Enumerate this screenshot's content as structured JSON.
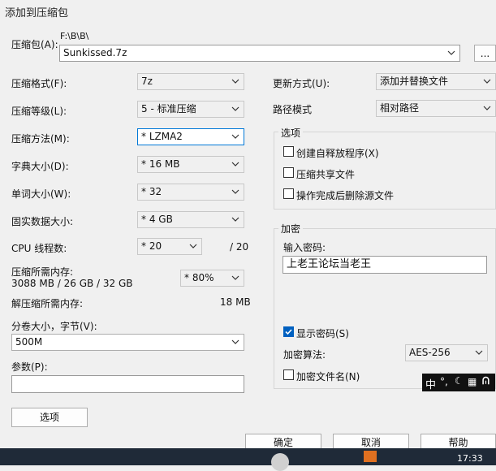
{
  "window": {
    "title": "添加到压缩包"
  },
  "archive": {
    "label": "压缩包(A):",
    "path": "F:\\B\\B\\",
    "name": "Sunkissed.7z",
    "browse": "..."
  },
  "left": {
    "format": {
      "label": "压缩格式(F):",
      "value": "7z"
    },
    "level": {
      "label": "压缩等级(L):",
      "value": "5 - 标准压缩"
    },
    "method": {
      "label": "压缩方法(M):",
      "value": "* LZMA2"
    },
    "dict": {
      "label": "字典大小(D):",
      "value": "* 16 MB"
    },
    "word": {
      "label": "单词大小(W):",
      "value": "* 32"
    },
    "solid": {
      "label": "固实数据大小:",
      "value": "* 4 GB"
    },
    "threads": {
      "label": "CPU 线程数:",
      "value": "* 20",
      "max": "/ 20"
    },
    "mem": {
      "label": "压缩所需内存:",
      "detail": "3088 MB / 26 GB / 32 GB",
      "value": "* 80%"
    },
    "decomp": {
      "label": "解压缩所需内存:",
      "value": "18 MB"
    },
    "split": {
      "label": "分卷大小，字节(V):",
      "value": "500M"
    },
    "params": {
      "label": "参数(P):",
      "value": ""
    },
    "options_btn": "选项"
  },
  "right": {
    "update": {
      "label": "更新方式(U):",
      "value": "添加并替换文件"
    },
    "pathmode": {
      "label": "路径模式",
      "value": "相对路径"
    },
    "options": {
      "title": "选项",
      "sfx": "创建自释放程序(X)",
      "shared": "压缩共享文件",
      "delete": "操作完成后删除源文件"
    },
    "encrypt": {
      "title": "加密",
      "pwd_label": "输入密码:",
      "pwd_value": "上老王论坛当老王",
      "show_pwd": "显示密码(S)",
      "algo_label": "加密算法:",
      "algo_value": "AES-256",
      "enc_names": "加密文件名(N)"
    }
  },
  "buttons": {
    "ok": "确定",
    "cancel": "取消",
    "help": "帮助"
  },
  "ime": {
    "text": "中"
  },
  "taskbar": {
    "time": "17:33"
  }
}
